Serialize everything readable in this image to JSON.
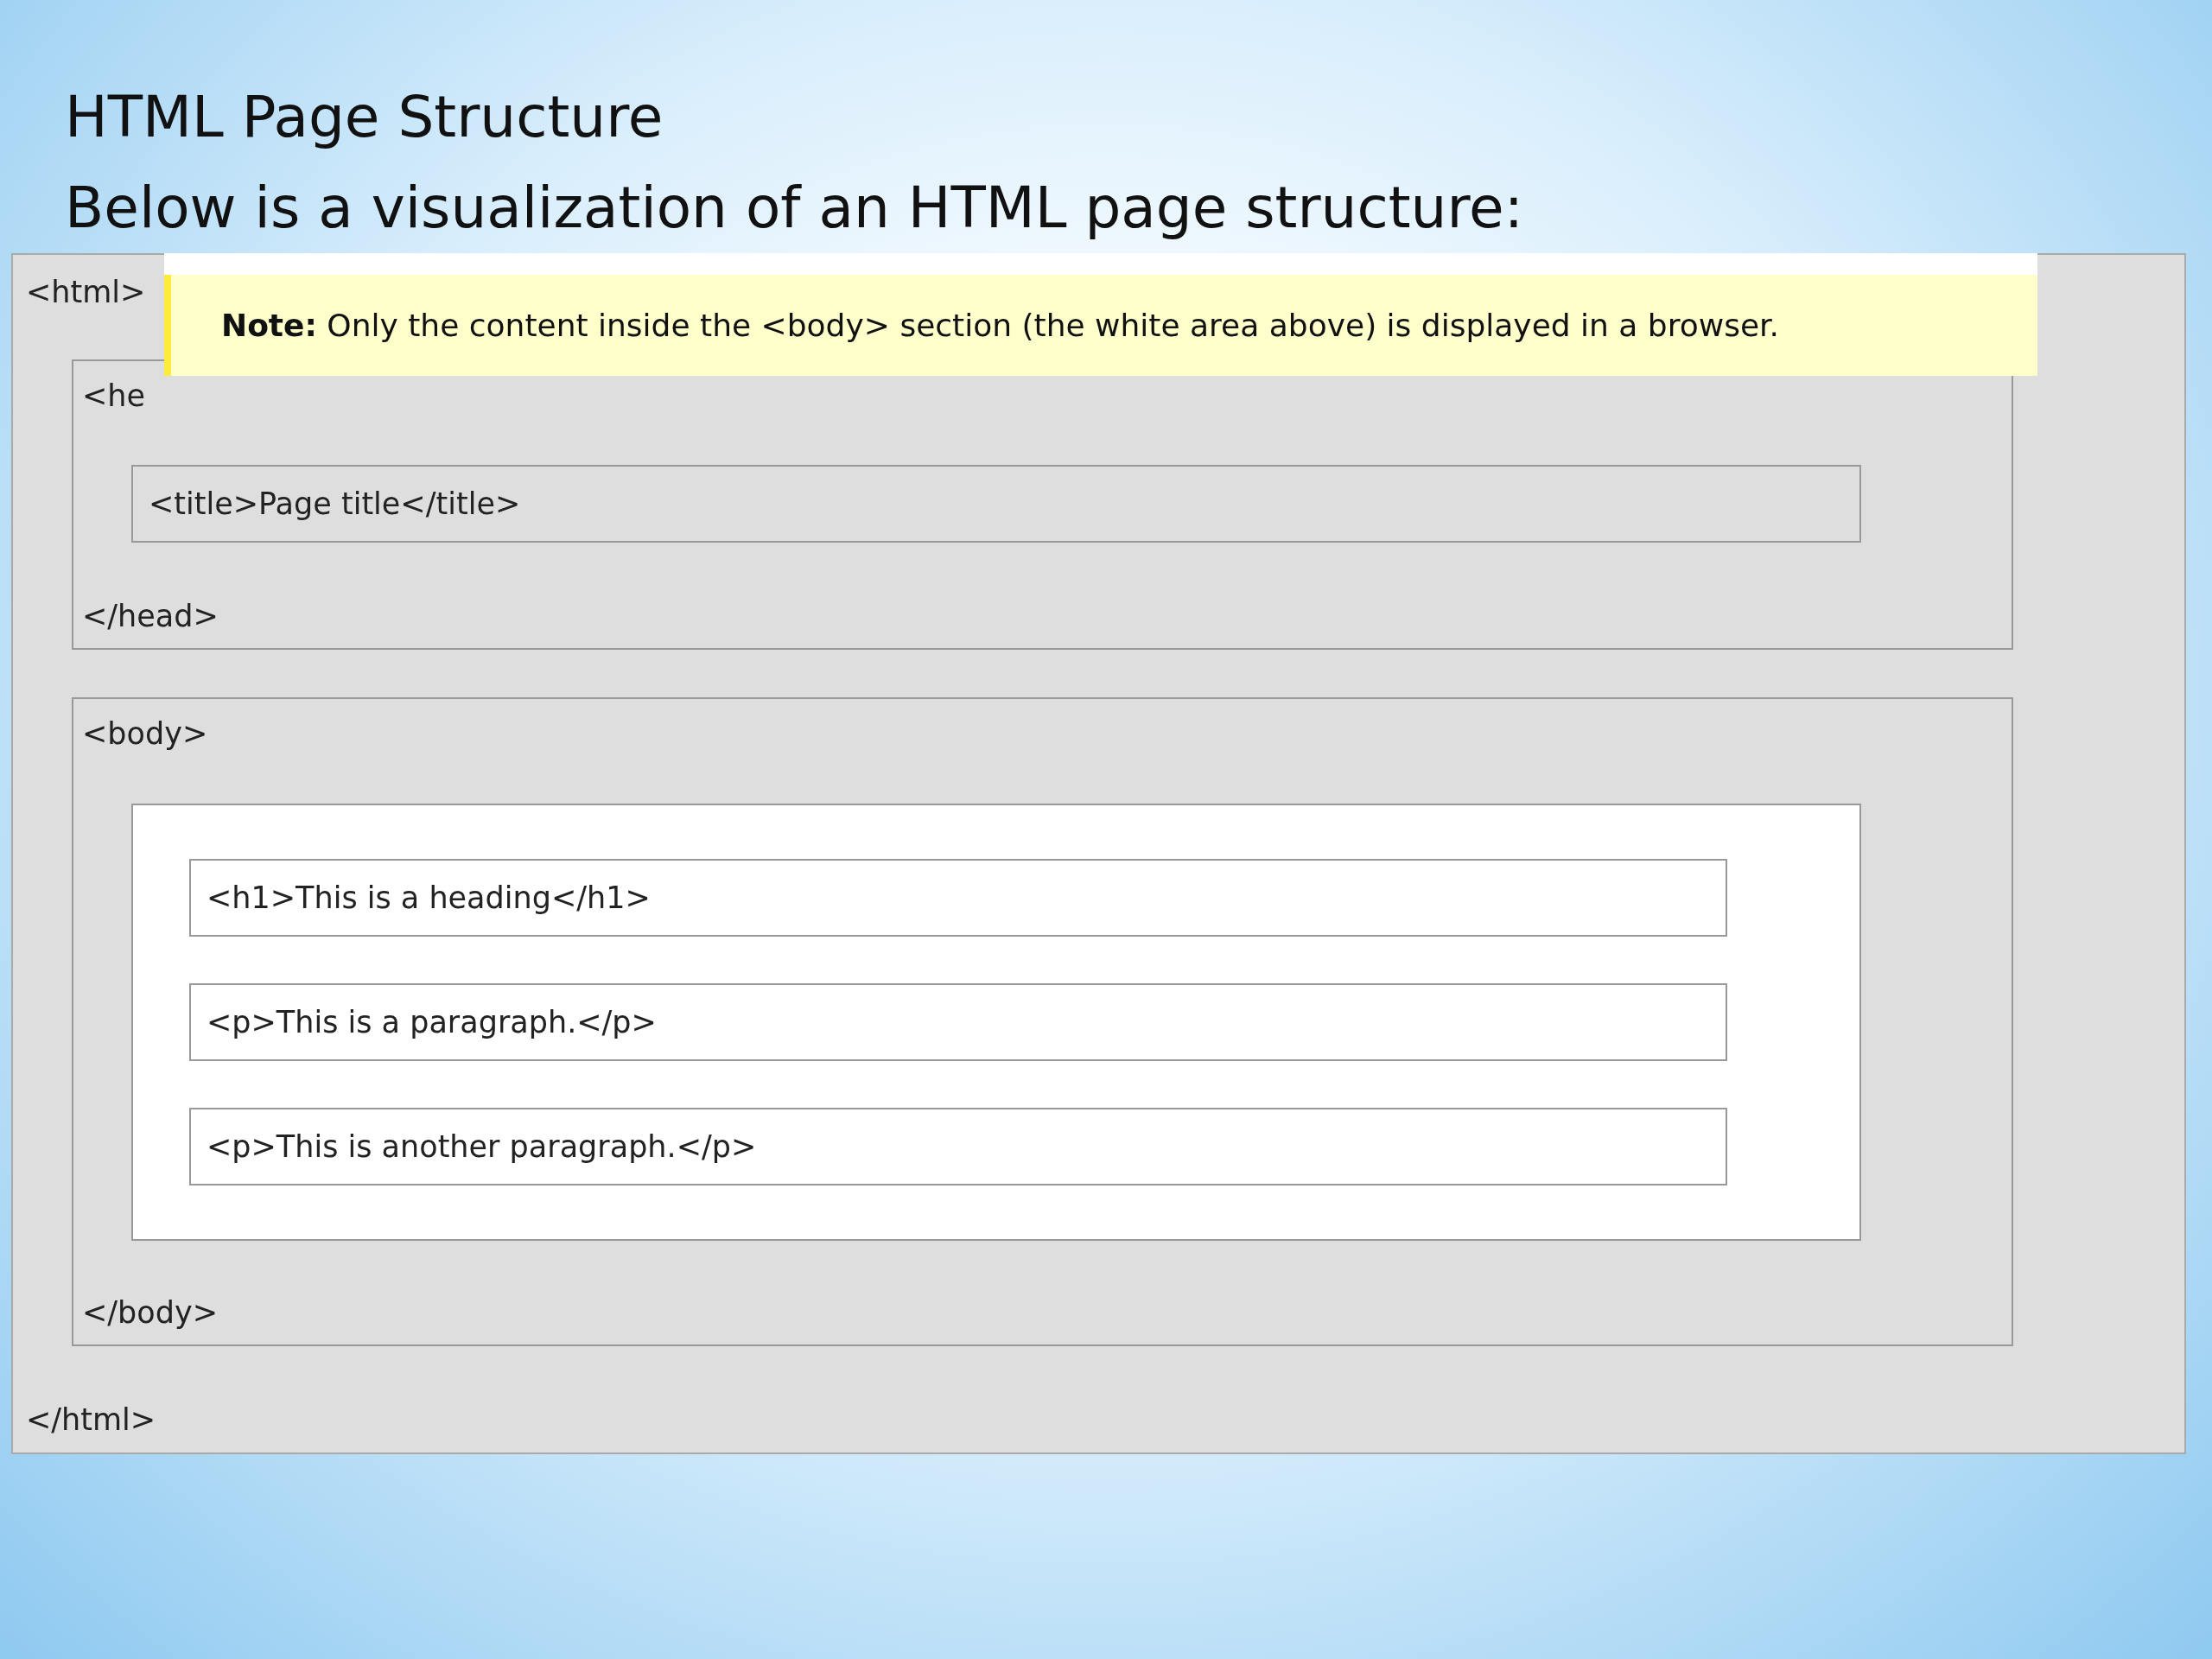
{
  "title": "HTML Page Structure",
  "subtitle": "Below is a visualization of an HTML page structure:",
  "diagram": {
    "html_open": "<html>",
    "head": {
      "open": "<he",
      "title_element": "<title>Page title</title>",
      "close": "</head>"
    },
    "body": {
      "open": "<body>",
      "elements": [
        "<h1>This is a heading</h1>",
        "<p>This is a paragraph.</p>",
        "<p>This is another paragraph.</p>"
      ],
      "close": "</body>"
    },
    "html_close": "</html>"
  },
  "note": "**Note:** Only the content inside the <body> section (the white area above) is displayed in a browser."
}
